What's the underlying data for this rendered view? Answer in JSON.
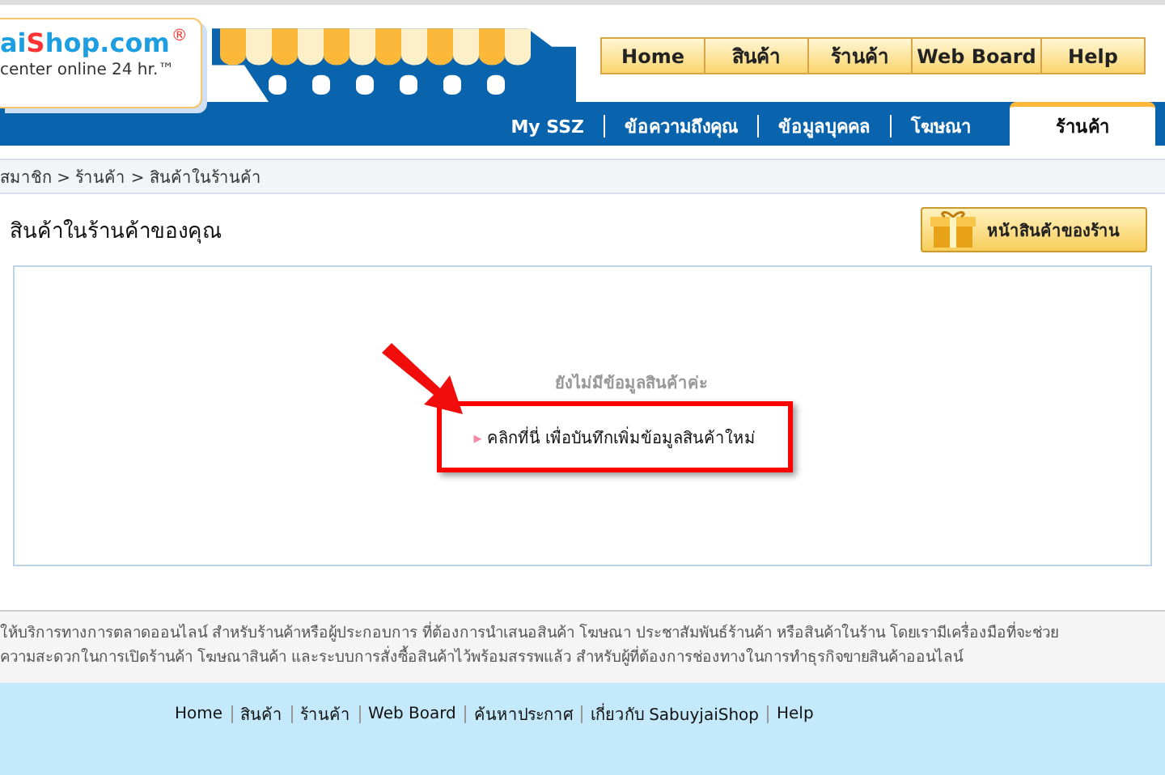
{
  "logo": {
    "lead": "ai",
    "accent": "S",
    "rest": "hop.com",
    "mark": "®",
    "tagline": "center online 24 hr.™"
  },
  "top_nav": [
    "Home",
    "สินค้า",
    "ร้านค้า",
    "Web Board",
    "Help"
  ],
  "tabs": [
    {
      "label": "My SSZ",
      "selected": false
    },
    {
      "label": "ข้อความถึงคุณ",
      "selected": false
    },
    {
      "label": "ข้อมูลบุคคล",
      "selected": false
    },
    {
      "label": "โฆษณา",
      "selected": false
    },
    {
      "label": "ร้านค้า",
      "selected": true
    }
  ],
  "breadcrumb": "สมาชิก > ร้านค้า > สินค้าในร้านค้า",
  "page_title": "สินค้าในร้านค้าของคุณ",
  "store_button": "หน้าสินค้าของร้าน",
  "empty_message": "ยังไม่มีข้อมูลสินค้าค่ะ",
  "add_link": {
    "bullet": "▸",
    "label": "คลิกที่นี่ เพื่อบันทึกเพิ่มข้อมูลสินค้าใหม่"
  },
  "footer_text": [
    "ให้บริการทางการตลาดออนไลน์ สำหรับร้านค้าหรือผู้ประกอบการ ที่ต้องการนำเสนอสินค้า โฆษณา ประชาสัมพันธ์ร้านค้า หรือสินค้าในร้าน โดยเรามีเครื่องมือที่จะช่วย",
    "ความสะดวกในการเปิดร้านค้า โฆษณาสินค้า และระบบการสั่งซื้อสินค้าไว้พร้อมสรรพแล้ว สำหรับผู้ที่ต้องการช่องทางในการทำธุรกิจขายสินค้าออนไลน์"
  ],
  "footer_links": [
    "Home",
    "สินค้า",
    "ร้านค้า",
    "Web Board",
    "ค้นหาประกาศ",
    "เกี่ยวกับ SabuyjaiShop",
    "Help"
  ]
}
